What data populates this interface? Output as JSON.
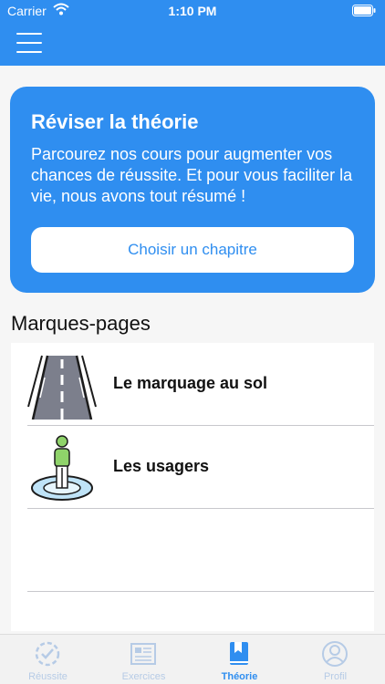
{
  "status_bar": {
    "carrier": "Carrier",
    "time": "1:10 PM",
    "icons": [
      "wifi-icon",
      "battery-icon"
    ]
  },
  "header": {
    "menu_icon": "hamburger-menu-icon",
    "color": "#2f8ef0"
  },
  "card": {
    "title": "Réviser la théorie",
    "text": "Parcourez nos cours pour augmenter vos chances de réussite. Et pour vous faciliter la vie, nous avons tout résumé !",
    "button_label": "Choisir un chapitre"
  },
  "bookmarks": {
    "title": "Marques-pages",
    "items": [
      {
        "label": "Le marquage au sol",
        "icon": "road-icon"
      },
      {
        "label": "Les usagers",
        "icon": "pedestrian-icon"
      }
    ]
  },
  "tabs": [
    {
      "label": "Réussite",
      "icon": "check-circle-icon",
      "active": false
    },
    {
      "label": "Exercices",
      "icon": "exercise-sheet-icon",
      "active": false
    },
    {
      "label": "Théorie",
      "icon": "bookmark-book-icon",
      "active": true
    },
    {
      "label": "Profil",
      "icon": "profile-icon",
      "active": false
    }
  ],
  "colors": {
    "accent": "#2f8ef0",
    "inactive_tab": "#b6cbe6"
  }
}
